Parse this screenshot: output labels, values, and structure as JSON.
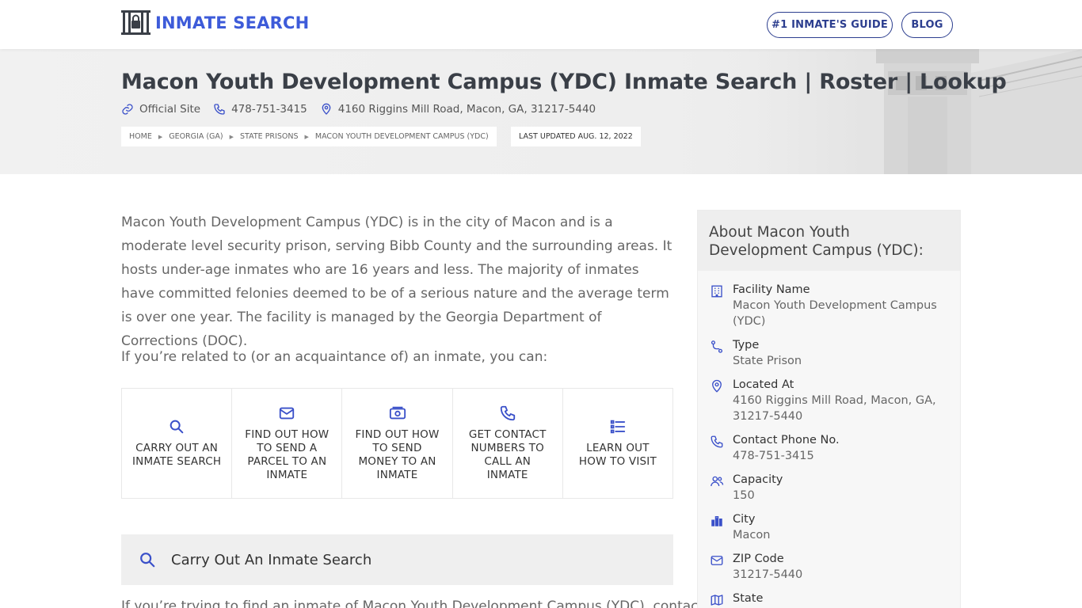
{
  "header": {
    "logo_text": "INMATE SEARCH",
    "nav": [
      {
        "label": "#1 INMATE'S GUIDE"
      },
      {
        "label": "BLOG"
      }
    ]
  },
  "hero": {
    "title": "Macon Youth Development Campus (YDC) Inmate Search | Roster | Lookup",
    "official_site": "Official Site",
    "phone": "478-751-3415",
    "address": "4160 Riggins Mill Road, Macon, GA, 31217-5440",
    "breadcrumbs": [
      "HOME",
      "GEORGIA (GA)",
      "STATE PRISONS",
      "MACON YOUTH DEVELOPMENT CAMPUS (YDC)"
    ],
    "last_updated": "LAST UPDATED AUG. 12, 2022"
  },
  "main": {
    "intro": "Macon Youth Development Campus (YDC) is in the city of Macon and is a moderate level security prison, serving Bibb County and the surrounding areas. It hosts under-age inmates who are 16 years and less. The majority of inmates have committed felonies deemed to be of a serious nature and the average term is over one year. The facility is managed by the Georgia Department of Corrections (DOC).",
    "intro2": "If you’re related to (or an acquaintance of) an inmate, you can:",
    "actions": [
      {
        "label": "CARRY OUT AN INMATE SEARCH",
        "icon": "search-icon"
      },
      {
        "label": "FIND OUT HOW TO SEND A PARCEL TO AN INMATE",
        "icon": "envelope-icon"
      },
      {
        "label": "FIND OUT HOW TO SEND MONEY TO AN INMATE",
        "icon": "money-icon"
      },
      {
        "label": "GET CONTACT NUMBERS TO CALL AN INMATE",
        "icon": "phone-icon"
      },
      {
        "label": "LEARN OUT HOW TO VISIT",
        "icon": "list-icon"
      }
    ],
    "section_title": "Carry Out An Inmate Search",
    "section_text": "If you’re trying to find an inmate of Macon Youth Development Campus (YDC), contact"
  },
  "sidebar": {
    "title": "About Macon Youth Development Campus (YDC):",
    "facts": [
      {
        "label": "Facility Name",
        "value": "Macon Youth Development Campus (YDC)",
        "icon": "building-icon"
      },
      {
        "label": "Type",
        "value": "State Prison",
        "icon": "route-icon"
      },
      {
        "label": "Located At",
        "value": "4160 Riggins Mill Road, Macon, GA, 31217-5440",
        "icon": "map-pin-icon"
      },
      {
        "label": "Contact Phone No.",
        "value": "478-751-3415",
        "icon": "phone-icon"
      },
      {
        "label": "Capacity",
        "value": "150",
        "icon": "users-icon"
      },
      {
        "label": "City",
        "value": "Macon",
        "icon": "city-icon"
      },
      {
        "label": "ZIP Code",
        "value": "31217-5440",
        "icon": "envelope-icon"
      },
      {
        "label": "State",
        "value": "",
        "icon": "map-icon"
      }
    ]
  },
  "colors": {
    "brand": "#3d5bd9",
    "nav_border": "#2c3e8f",
    "icon": "#3a50c9"
  }
}
